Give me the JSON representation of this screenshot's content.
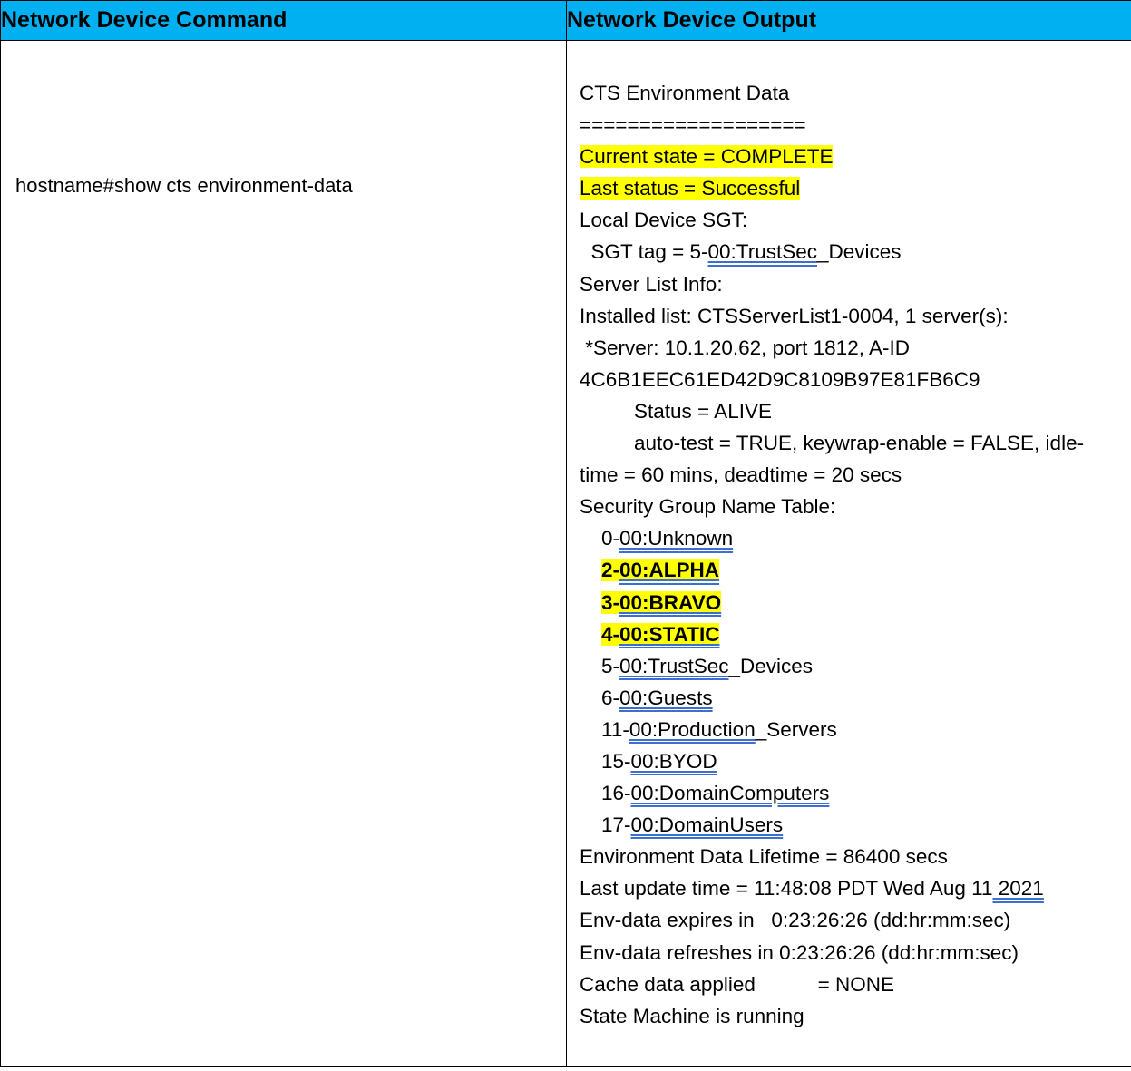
{
  "header": {
    "col1": "Network Device Command",
    "col2": "Network Device Output"
  },
  "colors": {
    "header_bg": "#00b0f0",
    "highlight": "#ffff00",
    "spell_underline": "#3c6fd0"
  },
  "command": "hostname#show cts environment-data",
  "output": {
    "title": "CTS Environment Data",
    "separator": "===================",
    "current_state": "Current state = COMPLETE",
    "last_status": "Last status = Successful",
    "local_sgt_label": "Local Device SGT:",
    "sgt_tag_prefix": "  SGT tag = 5-",
    "sgt_tag_link": "00:TrustSec",
    "sgt_tag_suffix": "_Devices",
    "server_list_label": "Server List Info:",
    "installed_list": "Installed list: CTSServerList1-0004, 1 server(s):",
    "server_line": " *Server: 10.1.20.62, port 1812, A-ID",
    "aid": "4C6B1EEC61ED42D9C8109B97E81FB6C9",
    "status": "Status = ALIVE",
    "autotest_1": "auto-test = TRUE, keywrap-enable = FALSE, idle-",
    "autotest_2": "time = 60 mins, deadtime = 20 secs",
    "sg_table_label": "Security Group Name Table:",
    "sg_table": [
      {
        "prefix": "0-",
        "name": "00:Unknown",
        "suffix": "",
        "highlight": false
      },
      {
        "prefix": "2-",
        "name": "00:ALPHA",
        "suffix": "",
        "highlight": true
      },
      {
        "prefix": "3-",
        "name": "00:BRAVO",
        "suffix": "",
        "highlight": true
      },
      {
        "prefix": "4-",
        "name": "00:STATIC",
        "suffix": "",
        "highlight": true
      },
      {
        "prefix": "5-",
        "name": "00:TrustSec",
        "suffix": "_Devices",
        "highlight": false
      },
      {
        "prefix": "6-",
        "name": "00:Guests",
        "suffix": "",
        "highlight": false
      },
      {
        "prefix": "11-",
        "name": "00:Production",
        "suffix": "_Servers",
        "highlight": false
      },
      {
        "prefix": "15-",
        "name": "00:BYOD",
        "suffix": "",
        "highlight": false
      },
      {
        "prefix": "16-",
        "name": "00:DomainComputers",
        "suffix": "",
        "highlight": false
      },
      {
        "prefix": "17-",
        "name": "00:DomainUsers",
        "suffix": "",
        "highlight": false
      }
    ],
    "lifetime": "Environment Data Lifetime = 86400 secs",
    "last_update_prefix": "Last update time = 11:48:08 PDT Wed Aug 11",
    "last_update_year": " 2021",
    "expires": "Env-data expires in   0:23:26:26 (dd:hr:mm:sec)",
    "refreshes": "Env-data refreshes in 0:23:26:26 (dd:hr:mm:sec)",
    "cache": "Cache data applied           = NONE",
    "state_machine": "State Machine is running"
  }
}
